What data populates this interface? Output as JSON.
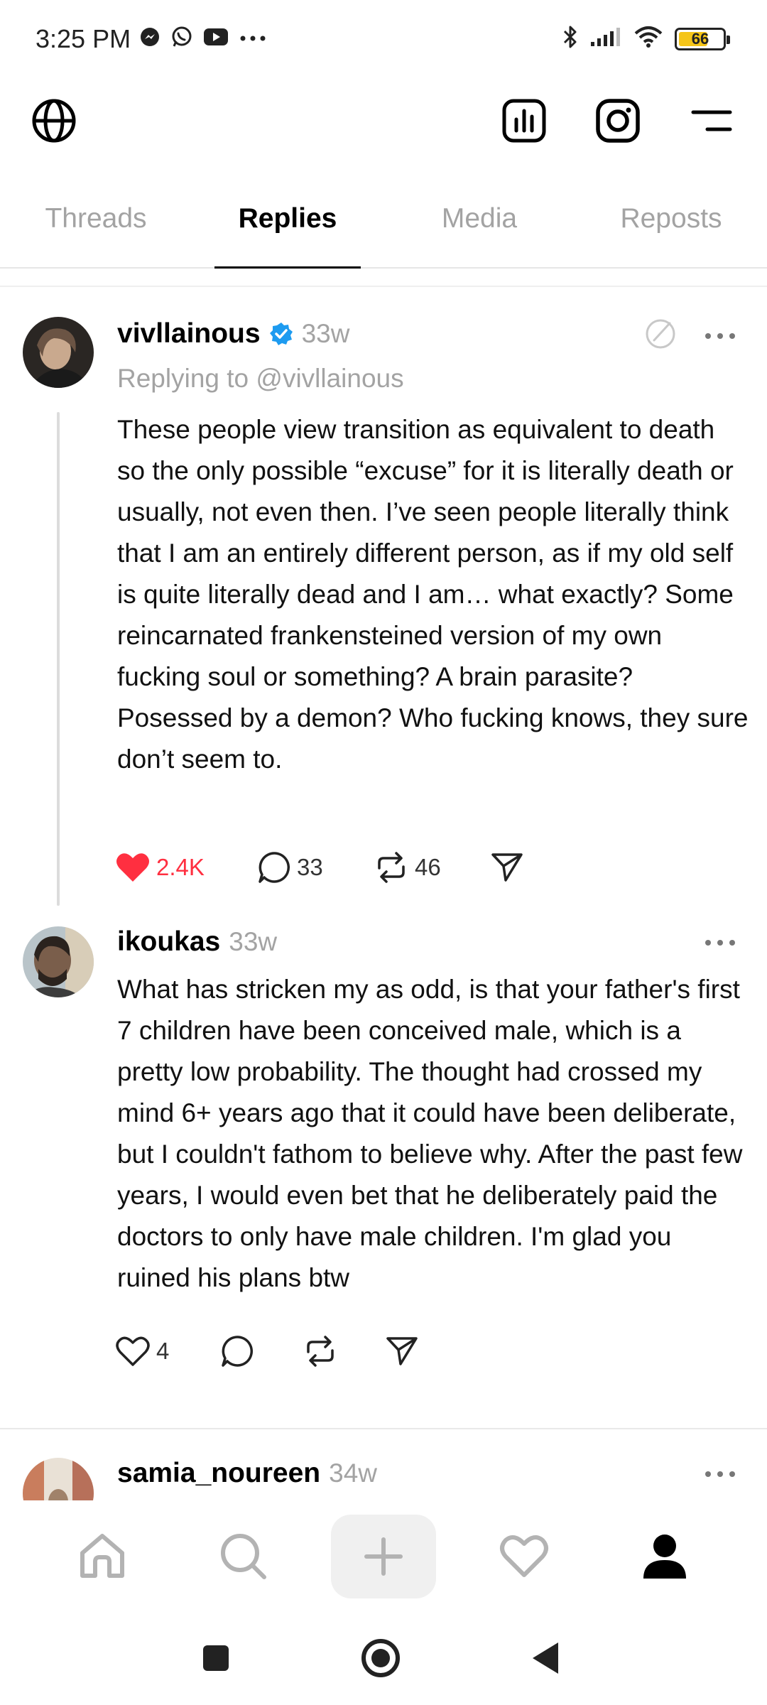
{
  "status_bar": {
    "time": "3:25 PM",
    "left_icons": [
      "messenger-icon",
      "whatsapp-icon",
      "youtube-icon",
      "more-dots-icon"
    ],
    "right_icons": [
      "bluetooth-icon",
      "signal-icon",
      "wifi-icon",
      "battery-icon"
    ],
    "battery_level": 66,
    "battery_label": "66",
    "battery_color": "#f5c518"
  },
  "top_bar": {
    "left_icon": "globe-icon",
    "right_icons": [
      "insights-icon",
      "instagram-icon",
      "menu-icon"
    ]
  },
  "tabs": [
    {
      "label": "Threads",
      "active": false
    },
    {
      "label": "Replies",
      "active": true
    },
    {
      "label": "Media",
      "active": false
    },
    {
      "label": "Reposts",
      "active": false
    }
  ],
  "posts": [
    {
      "username": "vivllainous",
      "verified": true,
      "time": "33w",
      "replying_to": "Replying to @vivllainous",
      "text": "These people view transition as equivalent to death so the only possible “excuse” for it is literally death or usually, not even then. I’ve seen people literally think that I am an entirely different person, as if my old self is quite literally dead and I am… what exactly? Some reincarnated frankensteined version of my own fucking soul or something? A brain parasite? Posessed by a demon? Who fucking knows, they sure don’t seem to.",
      "likes": "2.4K",
      "liked": true,
      "comments": "33",
      "reposts": "46"
    },
    {
      "username": "ikoukas",
      "verified": false,
      "time": "33w",
      "text": "What has stricken my as odd, is that your father's first 7 children have been conceived male, which is a pretty low probability. The thought had crossed my mind 6+ years ago that it could have been deliberate, but I couldn't fathom to believe why. After the past few years, I would even bet that he deliberately paid the doctors to only have male children. I'm glad you ruined his plans btw",
      "likes": "4",
      "liked": false
    },
    {
      "username": "samia_noureen",
      "verified": false,
      "time": "34w"
    }
  ],
  "bottom_nav": [
    "home-icon",
    "search-icon",
    "create-icon",
    "activity-icon",
    "profile-icon"
  ],
  "system_nav": [
    "recents-button",
    "home-button",
    "back-button"
  ],
  "colors": {
    "accent_like": "#ff2f40",
    "verified_blue": "#1d9bf0",
    "muted_text": "#a3a3a3"
  }
}
